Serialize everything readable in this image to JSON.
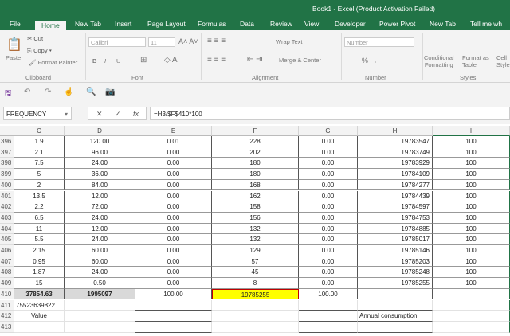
{
  "window": {
    "title": "Book1 - Excel (Product Activation Failed)"
  },
  "tabs": [
    "File",
    "Home",
    "New Tab",
    "Insert",
    "Page Layout",
    "Formulas",
    "Data",
    "Review",
    "View",
    "Developer",
    "Power Pivot",
    "New Tab",
    "Tell me wh"
  ],
  "active_tab": "Home",
  "ribbon": {
    "clipboard": {
      "paste": "Paste",
      "cut": "Cut",
      "copy": "Copy",
      "format_painter": "Format Painter",
      "label": "Clipboard"
    },
    "font": {
      "name": "Calibri",
      "size": "11",
      "bold": "B",
      "italic": "I",
      "underline": "U",
      "label": "Font"
    },
    "alignment": {
      "wrap": "Wrap Text",
      "merge": "Merge & Center",
      "label": "Alignment"
    },
    "number": {
      "format": "Number",
      "percent": "%",
      "comma": ",",
      "label": "Number"
    },
    "styles": {
      "conditional": "Conditional",
      "conditional2": "Formatting",
      "format_as": "Format as",
      "format_as2": "Table",
      "cell": "Cell",
      "cell2": "Styles",
      "label": "Styles"
    }
  },
  "formula_bar": {
    "name_box": "FREQUENCY",
    "formula": "=H3/$F$410*100",
    "cancel": "✕",
    "enter": "✓",
    "fx": "fx"
  },
  "columns": [
    "C",
    "D",
    "E",
    "F",
    "G",
    "H",
    "I"
  ],
  "rows": [
    {
      "n": "396",
      "c": [
        "1.9",
        "120.00",
        "0.01",
        "228",
        "0.00",
        "19783547",
        "100"
      ]
    },
    {
      "n": "397",
      "c": [
        "2.1",
        "96.00",
        "0.00",
        "202",
        "0.00",
        "19783749",
        "100"
      ]
    },
    {
      "n": "398",
      "c": [
        "7.5",
        "24.00",
        "0.00",
        "180",
        "0.00",
        "19783929",
        "100"
      ]
    },
    {
      "n": "399",
      "c": [
        "5",
        "36.00",
        "0.00",
        "180",
        "0.00",
        "19784109",
        "100"
      ]
    },
    {
      "n": "400",
      "c": [
        "2",
        "84.00",
        "0.00",
        "168",
        "0.00",
        "19784277",
        "100"
      ]
    },
    {
      "n": "401",
      "c": [
        "13.5",
        "12.00",
        "0.00",
        "162",
        "0.00",
        "19784439",
        "100"
      ]
    },
    {
      "n": "402",
      "c": [
        "2.2",
        "72.00",
        "0.00",
        "158",
        "0.00",
        "19784597",
        "100"
      ]
    },
    {
      "n": "403",
      "c": [
        "6.5",
        "24.00",
        "0.00",
        "156",
        "0.00",
        "19784753",
        "100"
      ]
    },
    {
      "n": "404",
      "c": [
        "11",
        "12.00",
        "0.00",
        "132",
        "0.00",
        "19784885",
        "100"
      ]
    },
    {
      "n": "405",
      "c": [
        "5.5",
        "24.00",
        "0.00",
        "132",
        "0.00",
        "19785017",
        "100"
      ]
    },
    {
      "n": "406",
      "c": [
        "2.15",
        "60.00",
        "0.00",
        "129",
        "0.00",
        "19785146",
        "100"
      ]
    },
    {
      "n": "407",
      "c": [
        "0.95",
        "60.00",
        "0.00",
        "57",
        "0.00",
        "19785203",
        "100"
      ]
    },
    {
      "n": "408",
      "c": [
        "1.87",
        "24.00",
        "0.00",
        "45",
        "0.00",
        "19785248",
        "100"
      ]
    },
    {
      "n": "409",
      "c": [
        "15",
        "0.50",
        "0.00",
        "8",
        "0.00",
        "19785255",
        "100"
      ]
    },
    {
      "n": "410",
      "c": [
        "37854.63",
        "1995097",
        "100.00",
        "19785255",
        "100.00",
        "",
        ""
      ]
    },
    {
      "n": "411",
      "c": [
        "75523639822",
        "",
        "",
        "",
        "",
        "",
        ""
      ]
    },
    {
      "n": "412",
      "c": [
        "Value",
        "",
        "",
        "",
        "",
        "Annual consumption",
        ""
      ]
    },
    {
      "n": "413",
      "c": [
        "",
        "",
        "",
        "",
        "",
        "",
        ""
      ]
    }
  ],
  "colors": {
    "excel_green": "#217346",
    "highlight": "#ffff00",
    "selection_border": "#c00000"
  }
}
